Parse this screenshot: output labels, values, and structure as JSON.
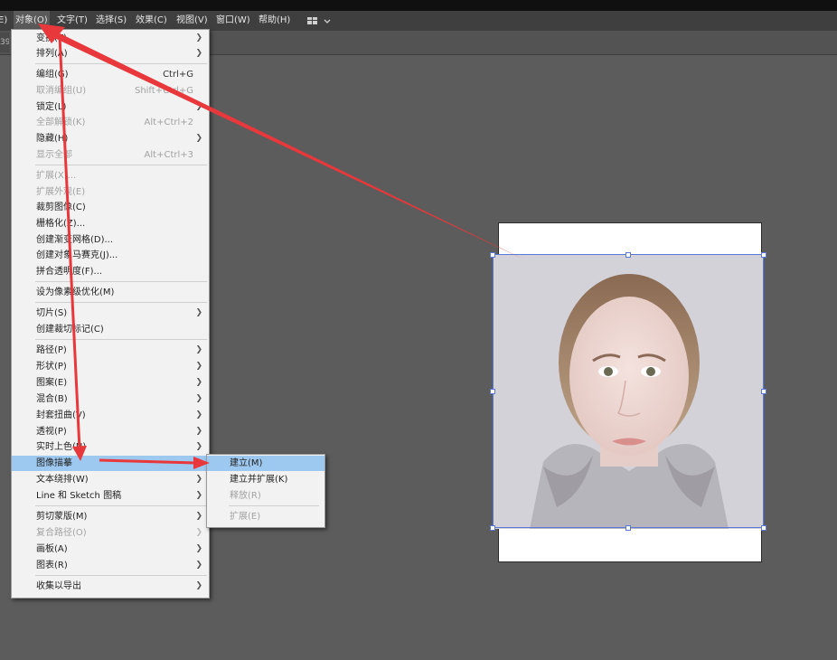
{
  "menubar": {
    "items": [
      {
        "label": "E)"
      },
      {
        "label": "对象(O)"
      },
      {
        "label": "文字(T)"
      },
      {
        "label": "选择(S)"
      },
      {
        "label": "效果(C)"
      },
      {
        "label": "视图(V)"
      },
      {
        "label": "窗口(W)"
      },
      {
        "label": "帮助(H)"
      }
    ],
    "workspace_icon": "grid-layout-icon",
    "tab_stub": "39"
  },
  "object_menu": {
    "items": [
      {
        "label": "变换(T)",
        "submenu": true
      },
      {
        "label": "排列(A)",
        "submenu": true
      },
      {
        "label": "编组(G)",
        "shortcut": "Ctrl+G"
      },
      {
        "label": "取消编组(U)",
        "shortcut": "Shift+Ctrl+G",
        "disabled": true
      },
      {
        "label": "锁定(L)",
        "submenu": true
      },
      {
        "label": "全部解锁(K)",
        "shortcut": "Alt+Ctrl+2",
        "disabled": true
      },
      {
        "label": "隐藏(H)",
        "submenu": true
      },
      {
        "label": "显示全部",
        "shortcut": "Alt+Ctrl+3",
        "disabled": true
      },
      {
        "label": "扩展(X)...",
        "disabled": true
      },
      {
        "label": "扩展外观(E)",
        "disabled": true
      },
      {
        "label": "裁剪图像(C)"
      },
      {
        "label": "栅格化(Z)..."
      },
      {
        "label": "创建渐变网格(D)..."
      },
      {
        "label": "创建对象马赛克(J)..."
      },
      {
        "label": "拼合透明度(F)..."
      },
      {
        "label": "设为像素级优化(M)"
      },
      {
        "label": "切片(S)",
        "submenu": true
      },
      {
        "label": "创建裁切标记(C)"
      },
      {
        "label": "路径(P)",
        "submenu": true
      },
      {
        "label": "形状(P)",
        "submenu": true
      },
      {
        "label": "图案(E)",
        "submenu": true
      },
      {
        "label": "混合(B)",
        "submenu": true
      },
      {
        "label": "封套扭曲(V)",
        "submenu": true
      },
      {
        "label": "透视(P)",
        "submenu": true
      },
      {
        "label": "实时上色(N)",
        "submenu": true
      },
      {
        "label": "图像描摹",
        "submenu": true,
        "highlighted": true
      },
      {
        "label": "文本绕排(W)",
        "submenu": true
      },
      {
        "label": "Line 和 Sketch 图稿",
        "submenu": true
      },
      {
        "label": "剪切蒙版(M)",
        "submenu": true
      },
      {
        "label": "复合路径(O)",
        "submenu": true,
        "disabled": true
      },
      {
        "label": "画板(A)",
        "submenu": true
      },
      {
        "label": "图表(R)",
        "submenu": true
      },
      {
        "label": "收集以导出",
        "submenu": true
      }
    ]
  },
  "image_trace_submenu": {
    "items": [
      {
        "label": "建立(M)",
        "highlighted": true
      },
      {
        "label": "建立并扩展(K)"
      },
      {
        "label": "释放(R)",
        "disabled": true
      },
      {
        "label": "扩展(E)",
        "disabled": true
      }
    ]
  },
  "colors": {
    "annotation_arrow": "#e8383b",
    "selection": "#5a78d8",
    "menu_highlight": "#9dc8ef"
  }
}
